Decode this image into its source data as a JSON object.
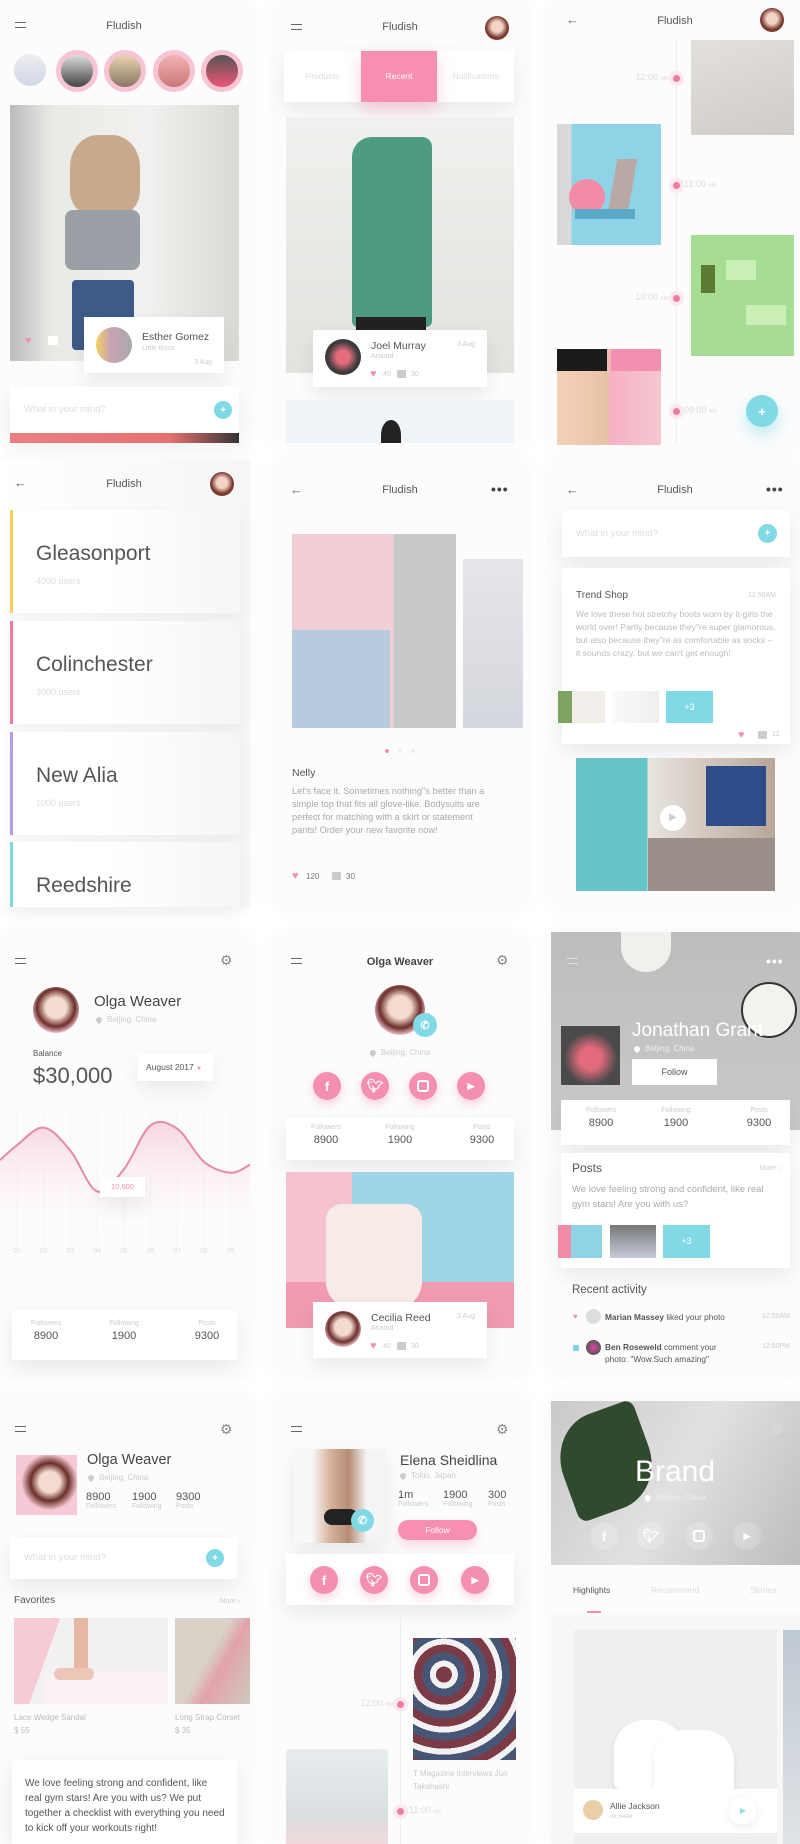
{
  "app_title": "Fludish",
  "colors": {
    "accent_pink": "#f48fb1",
    "accent_cyan": "#82d9e6",
    "text": "#555555"
  },
  "screen1": {
    "author": {
      "name": "Esther Gomez",
      "subtitle": "Little Boss",
      "date": "3 Aug"
    },
    "composer_placeholder": "What in your mind?",
    "composer_button": "+"
  },
  "screen2": {
    "tabs": [
      "Products",
      "Recent",
      "Notifications"
    ],
    "active_tab": "Recent",
    "post": {
      "name": "Joel Murray",
      "subtitle": "Around",
      "date": "3 Aug",
      "likes": "40",
      "comments": "30"
    }
  },
  "screen3": {
    "times": [
      "12:00",
      "11:00",
      "10:00",
      "09:00"
    ],
    "time_suffix": "AM",
    "fab": "+"
  },
  "screen4": {
    "cities": [
      {
        "name": "Gleasonport",
        "users": "4000 users",
        "color": "#f5cf5a"
      },
      {
        "name": "Colinchester",
        "users": "3000 users",
        "color": "#f07ba0"
      },
      {
        "name": "New Alia",
        "users": "1000 users",
        "color": "#b59be8"
      },
      {
        "name": "Reedshire",
        "users": "",
        "color": "#7fd8e0"
      }
    ]
  },
  "screen5": {
    "author": "Nelly",
    "text": "Let's face it. Sometimes nothing''s better than a simple top that fits all glove-like. Bodysuits are perfect for matching with a skirt or statement pants! Order your new favorite now!",
    "likes": "120",
    "comments": "30"
  },
  "screen6": {
    "composer_placeholder": "What in your mind?",
    "post": {
      "title": "Trend Shop",
      "time": "12:50AM",
      "text": "We love these hot stretchy boots worn by it-girls the world over! Partly because they''re super glamorous, but also because they''re as comfortable as socks – it sounds crazy, but we can't get enough!",
      "more_count": "+3",
      "comments": "12"
    }
  },
  "screen7": {
    "name": "Olga Weaver",
    "location": "Beijing, China",
    "balance_label": "Balance",
    "balance": "$30,000",
    "period": "August 2017",
    "stats": [
      {
        "label": "Followers",
        "value": "8900"
      },
      {
        "label": "Following",
        "value": "1900"
      },
      {
        "label": "Posts",
        "value": "9300"
      }
    ]
  },
  "chart_data": {
    "type": "area",
    "categories": [
      "01",
      "02",
      "03",
      "04",
      "05",
      "06",
      "07",
      "08",
      "09"
    ],
    "values": [
      12800,
      14400,
      12300,
      8600,
      10600,
      14600,
      14300,
      11300,
      10300
    ],
    "tooltip": "10,600",
    "tooltip_category": "05",
    "grid": true,
    "color": "#e58aa8"
  },
  "screen8": {
    "title": "Olga Weaver",
    "location": "Beijing, China",
    "socials": [
      "facebook",
      "twitter",
      "instagram",
      "youtube"
    ],
    "stats": [
      {
        "label": "Followers",
        "value": "8900"
      },
      {
        "label": "Following",
        "value": "1900"
      },
      {
        "label": "Posts",
        "value": "9300"
      }
    ],
    "post": {
      "name": "Cecilia Reed",
      "subtitle": "Around",
      "date": "3 Aug",
      "likes": "40",
      "comments": "30"
    }
  },
  "screen9": {
    "name": "Jonathan Grant",
    "location": "Beijing, China",
    "follow": "Follow",
    "stats": [
      {
        "label": "Followers",
        "value": "8900"
      },
      {
        "label": "Following",
        "value": "1900"
      },
      {
        "label": "Posts",
        "value": "9300"
      }
    ],
    "posts_title": "Posts",
    "more": "More ›",
    "posts_text": "We love feeling strong and confident, like real gym stars! Are you with us?",
    "more_count": "+3",
    "activity_title": "Recent activity",
    "activity": [
      {
        "user": "Marian Massey",
        "action": " liked your photo",
        "time": "12:50AM"
      },
      {
        "user": "Ben Roseweld",
        "action": " comment your photo: \"Wow.Such amazing\"",
        "time": "12:50PM"
      }
    ]
  },
  "screen10": {
    "name": "Olga Weaver",
    "location": "Beijing, China",
    "stats": [
      {
        "label": "Followers",
        "value": "8900"
      },
      {
        "label": "Following",
        "value": "1900"
      },
      {
        "label": "Posts",
        "value": "9300"
      }
    ],
    "composer_placeholder": "What in your mind?",
    "favorites_title": "Favorites",
    "more": "More ›",
    "favorites": [
      {
        "name": "Lace Wedge Sandal",
        "price": "$ 55"
      },
      {
        "name": "Long Strap Corset",
        "price": "$ 35"
      }
    ],
    "quote": "We love feeling strong and confident, like real gym stars! Are you with us? We put together a checklist with everything you need to kick off your workouts right!"
  },
  "screen11": {
    "name": "Elena Sheidlina",
    "location": "Tokio, Japan",
    "stats": [
      {
        "label": "Followers",
        "value": "1m"
      },
      {
        "label": "Following",
        "value": "1900"
      },
      {
        "label": "Posts",
        "value": "300"
      }
    ],
    "follow": "Follow",
    "times": [
      "12:00",
      "11:00"
    ],
    "time_suffix": "AM",
    "caption": "T Magazine interviews Jun Takahashi"
  },
  "screen12": {
    "brand": "Brand",
    "location": "Beijing, China",
    "tabs": [
      "Highlights",
      "Recommend",
      "Stories"
    ],
    "active_tab": "Highlights",
    "card": {
      "name": "Allie Jackson",
      "time": "09:34AM"
    }
  }
}
